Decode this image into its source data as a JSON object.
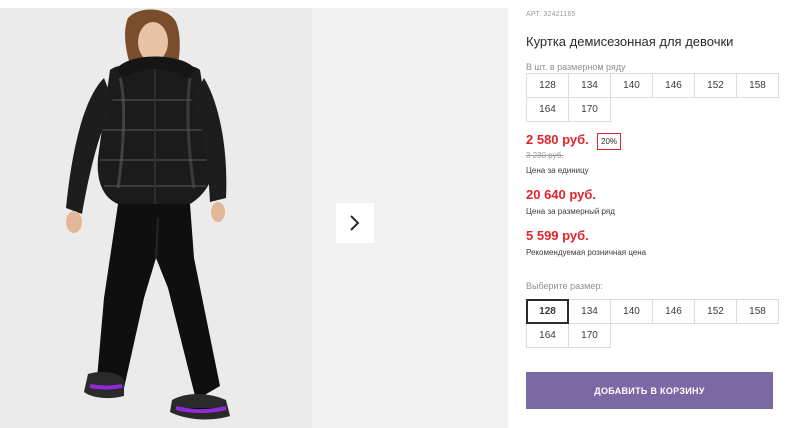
{
  "product": {
    "sku": "АРТ. 32421165",
    "title": "Куртка демисезонная для девочки"
  },
  "size_row": {
    "label": "В шт. в размерном ряду",
    "sizes": [
      "128",
      "134",
      "140",
      "146",
      "152",
      "158",
      "164",
      "170"
    ]
  },
  "pricing": {
    "unit_price": "2 580 руб.",
    "discount": "20%",
    "old_price": "3 230 руб.",
    "unit_caption": "Цена за единицу",
    "row_price": "20 640 руб.",
    "row_caption": "Цена за размерный ряд",
    "retail_price": "5 599 руб.",
    "retail_caption": "Рекомендуемая розничная цена"
  },
  "size_select": {
    "label": "Выберите размер:",
    "sizes": [
      "128",
      "134",
      "140",
      "146",
      "152",
      "158",
      "164",
      "170"
    ],
    "selected": "128"
  },
  "cart": {
    "button_label": "ДОБАВИТЬ В КОРЗИНУ"
  },
  "gallery": {
    "next_icon": "chevron-right-icon",
    "image": "product-photo-girl-black-puffer-jacket"
  },
  "colors": {
    "price": "#e0242d",
    "button": "#7b69a6",
    "accent_purple": "#8e2bd6"
  }
}
